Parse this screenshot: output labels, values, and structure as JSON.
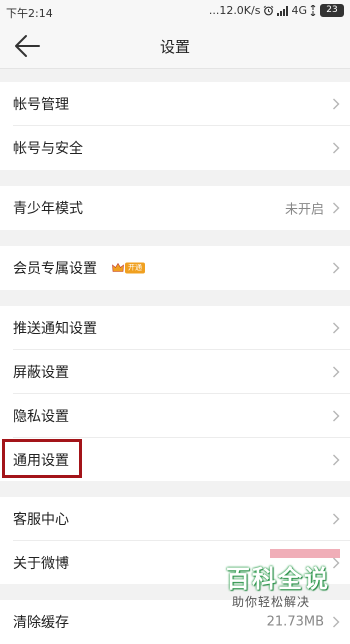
{
  "status_bar": {
    "time": "下午2:14",
    "network_speed": "...12.0K/s",
    "network_type": "4G",
    "battery": "23"
  },
  "header": {
    "title": "设置",
    "back_icon": "arrow-left-icon"
  },
  "settings": {
    "account_management": "帐号管理",
    "account_security": "帐号与安全",
    "youth_mode": "青少年模式",
    "youth_mode_status": "未开启",
    "member_settings": "会员专属设置",
    "member_badge": "开通",
    "push_notifications": "推送通知设置",
    "block_settings": "屏蔽设置",
    "privacy_settings": "隐私设置",
    "general_settings": "通用设置",
    "customer_service": "客服中心",
    "about_weibo": "关于微博",
    "clear_cache": "清除缓存",
    "cache_size": "21.73MB"
  },
  "watermark": {
    "title": "百科全说",
    "subtitle": "助你轻松解决"
  },
  "colors": {
    "highlight_border": "#a31419",
    "watermark_green": "#2e9e4f",
    "badge_orange": "#f0a020"
  }
}
